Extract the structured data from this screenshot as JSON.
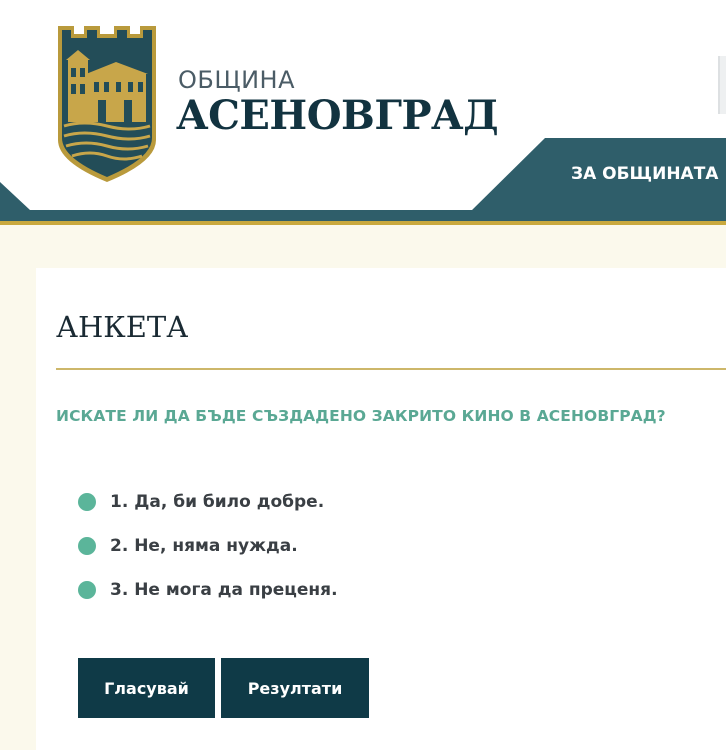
{
  "header": {
    "municipality_label": "ОБЩИНА",
    "city_name": "АСЕНОВГРАД",
    "nav": [
      {
        "label": "ЗА ОБЩИНАТА"
      }
    ]
  },
  "poll": {
    "title": "АНКЕТА",
    "question": "ИСКАТЕ ЛИ ДА БЪДЕ СЪЗДАДЕНО ЗАКРИТО КИНО В АСЕНОВГРАД?",
    "options": [
      {
        "label": "1. Да, би било добре."
      },
      {
        "label": "2. Не, няма нужда."
      },
      {
        "label": "3. Не мога да преценя."
      }
    ],
    "vote_button": "Гласувай",
    "results_button": "Резултати"
  },
  "colors": {
    "teal_band": "#2f5e6a",
    "gold_line": "#c9a93e",
    "accent_green": "#5bb59a",
    "button_bg": "#0f3a47"
  },
  "icons": {
    "crest": "asenovgrad-crest-icon",
    "option_marker": "radio-dot-icon"
  }
}
